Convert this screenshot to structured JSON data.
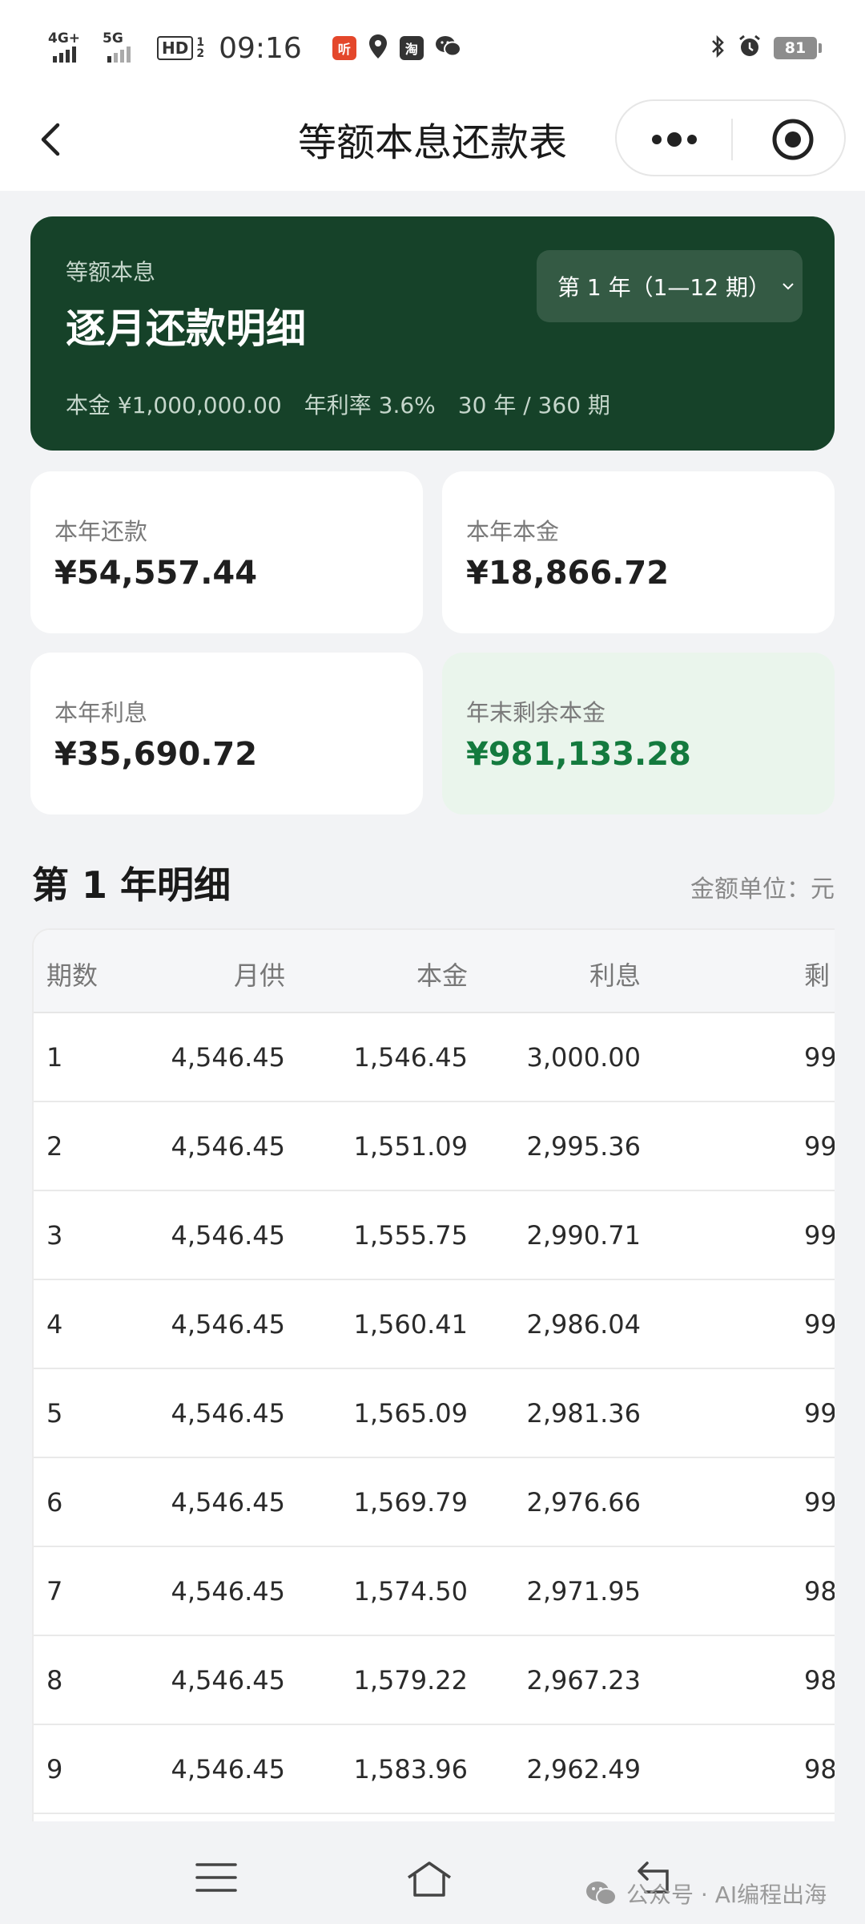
{
  "status_bar": {
    "network1": "4G+",
    "network2": "5G",
    "hd": "HD",
    "hd_sub": "1\n2",
    "time": "09:16",
    "app1": "听",
    "app2": "淘",
    "battery": "81"
  },
  "nav": {
    "title": "等额本息还款表"
  },
  "hero": {
    "subtitle": "等额本息",
    "title": "逐月还款明细",
    "year_select": "第 1 年（1—12 期）",
    "principal": "本金 ¥1,000,000.00",
    "rate": "年利率 3.6%",
    "term": "30 年 / 360 期"
  },
  "stats": [
    {
      "label": "本年还款",
      "value": "¥54,557.44"
    },
    {
      "label": "本年本金",
      "value": "¥18,866.72"
    },
    {
      "label": "本年利息",
      "value": "¥35,690.72"
    },
    {
      "label": "年末剩余本金",
      "value": "¥981,133.28"
    }
  ],
  "section": {
    "title": "第 1 年明细",
    "unit": "金额单位：元"
  },
  "table": {
    "headers": [
      "期数",
      "月供",
      "本金",
      "利息",
      "剩"
    ],
    "rows": [
      [
        "1",
        "4,546.45",
        "1,546.45",
        "3,000.00",
        "99"
      ],
      [
        "2",
        "4,546.45",
        "1,551.09",
        "2,995.36",
        "99"
      ],
      [
        "3",
        "4,546.45",
        "1,555.75",
        "2,990.71",
        "99"
      ],
      [
        "4",
        "4,546.45",
        "1,560.41",
        "2,986.04",
        "99"
      ],
      [
        "5",
        "4,546.45",
        "1,565.09",
        "2,981.36",
        "99"
      ],
      [
        "6",
        "4,546.45",
        "1,569.79",
        "2,976.66",
        "99"
      ],
      [
        "7",
        "4,546.45",
        "1,574.50",
        "2,971.95",
        "98"
      ],
      [
        "8",
        "4,546.45",
        "1,579.22",
        "2,967.23",
        "98"
      ],
      [
        "9",
        "4,546.45",
        "1,583.96",
        "2,962.49",
        "98"
      ]
    ]
  },
  "watermark": "公众号 · AI编程出海",
  "colors": {
    "hero_bg": "#164229",
    "accent_green": "#147a3e",
    "stat_green_bg": "#eaf5ec"
  }
}
